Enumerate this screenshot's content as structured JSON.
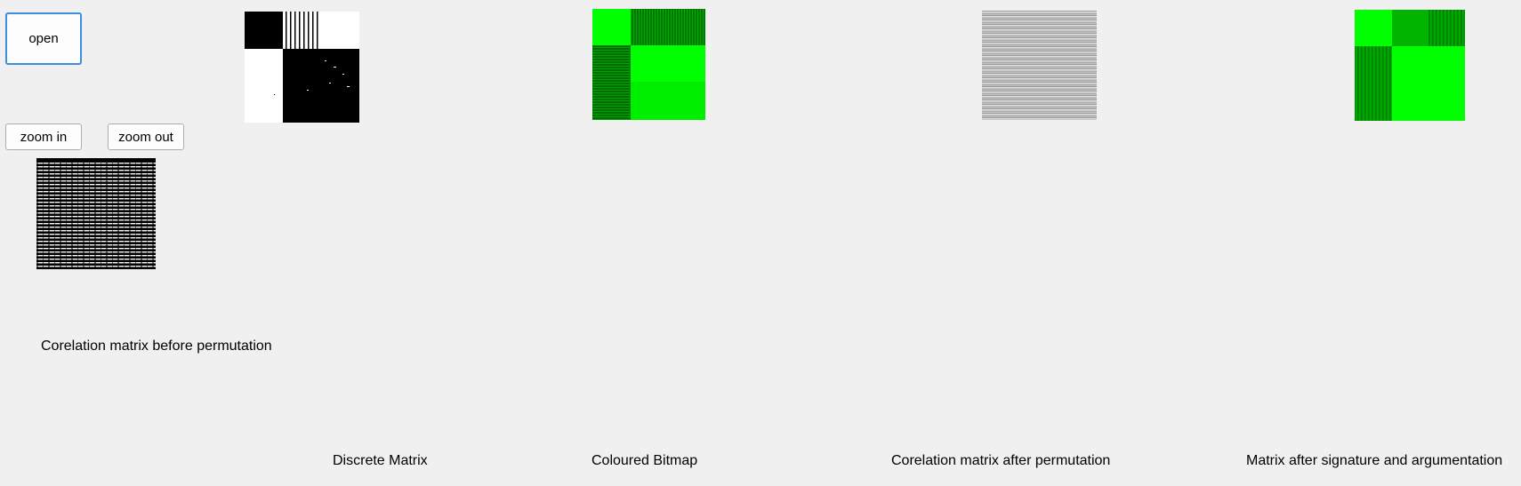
{
  "buttons": {
    "open": "open",
    "zoom_in": "zoom in",
    "zoom_out": "zoom out"
  },
  "labels": {
    "before": "Corelation matrix before permutation",
    "discrete": "Discrete Matrix",
    "coloured": "Coloured Bitmap",
    "after": "Corelation matrix after permutation",
    "signature": "Matrix after signature and argumentation"
  },
  "colors": {
    "background": "#f0f0f0",
    "bright_green": "#00ff00",
    "dark_green": "#007a00",
    "focus_border": "#3d8ee0"
  }
}
